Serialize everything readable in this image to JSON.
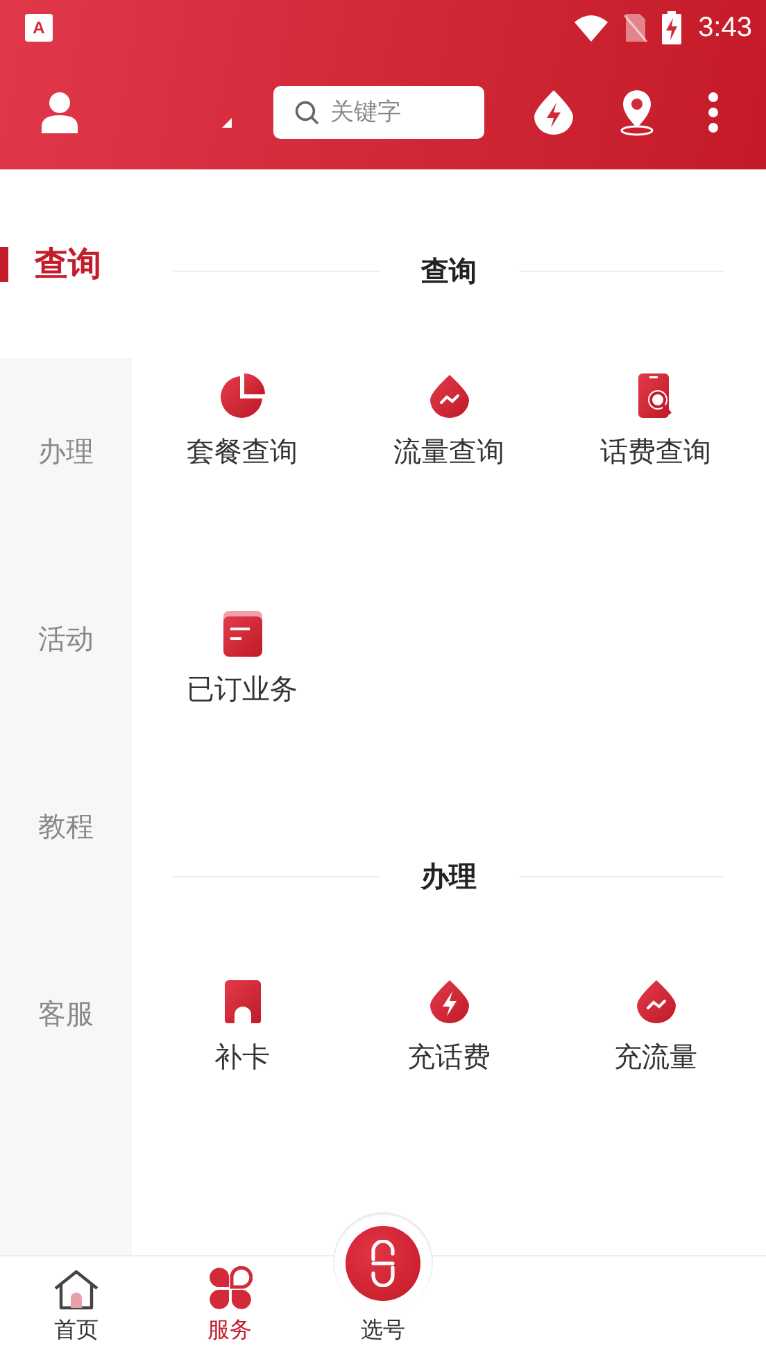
{
  "status_bar": {
    "notification_label": "A",
    "time": "3:43"
  },
  "header": {
    "search": {
      "placeholder": "关键字"
    }
  },
  "sidebar": {
    "items": [
      {
        "label": "查询",
        "selected": true
      },
      {
        "label": "办理",
        "selected": false
      },
      {
        "label": "活动",
        "selected": false
      },
      {
        "label": "教程",
        "selected": false
      },
      {
        "label": "客服",
        "selected": false
      }
    ]
  },
  "sections": [
    {
      "title": "查询",
      "items": [
        {
          "label": "套餐查询",
          "kind": "pie"
        },
        {
          "label": "流量查询",
          "kind": "drop-trend"
        },
        {
          "label": "话费查询",
          "kind": "phone-search"
        },
        {
          "label": "已订业务",
          "kind": "document"
        }
      ]
    },
    {
      "title": "办理",
      "items": [
        {
          "label": "补卡",
          "kind": "card"
        },
        {
          "label": "充话费",
          "kind": "drop-bolt"
        },
        {
          "label": "充流量",
          "kind": "drop-trend"
        }
      ]
    }
  ],
  "bottom_nav": [
    {
      "label": "首页",
      "kind": "home",
      "selected": false
    },
    {
      "label": "服务",
      "kind": "clover",
      "selected": true
    },
    {
      "label": "选号",
      "kind": "center",
      "selected": false
    }
  ]
}
